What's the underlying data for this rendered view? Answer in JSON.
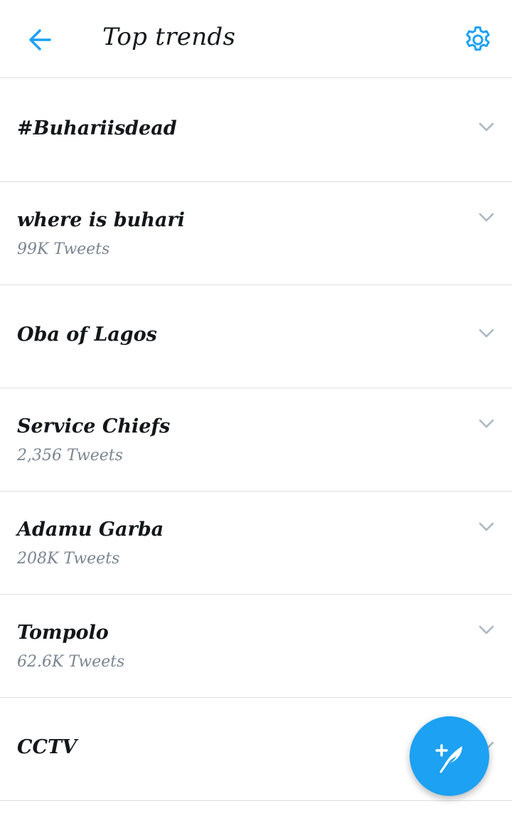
{
  "header": {
    "title": "Top trends"
  },
  "trends": [
    {
      "name": "#Buhariisdead",
      "count": ""
    },
    {
      "name": "where is buhari",
      "count": "99K Tweets"
    },
    {
      "name": "Oba of Lagos",
      "count": ""
    },
    {
      "name": "Service Chiefs",
      "count": "2,356 Tweets"
    },
    {
      "name": "Adamu Garba",
      "count": "208K Tweets"
    },
    {
      "name": "Tompolo",
      "count": "62.6K Tweets"
    },
    {
      "name": "CCTV",
      "count": ""
    }
  ],
  "colors": {
    "accent": "#1da1f2",
    "text": "#14171a",
    "secondary_text": "#7a8590",
    "divider": "#dcdfe2",
    "chevron": "#aab8c2"
  },
  "icons": {
    "back": "arrow-left-icon",
    "settings": "gear-icon",
    "expand": "chevron-down-icon",
    "compose": "compose-tweet-icon"
  }
}
